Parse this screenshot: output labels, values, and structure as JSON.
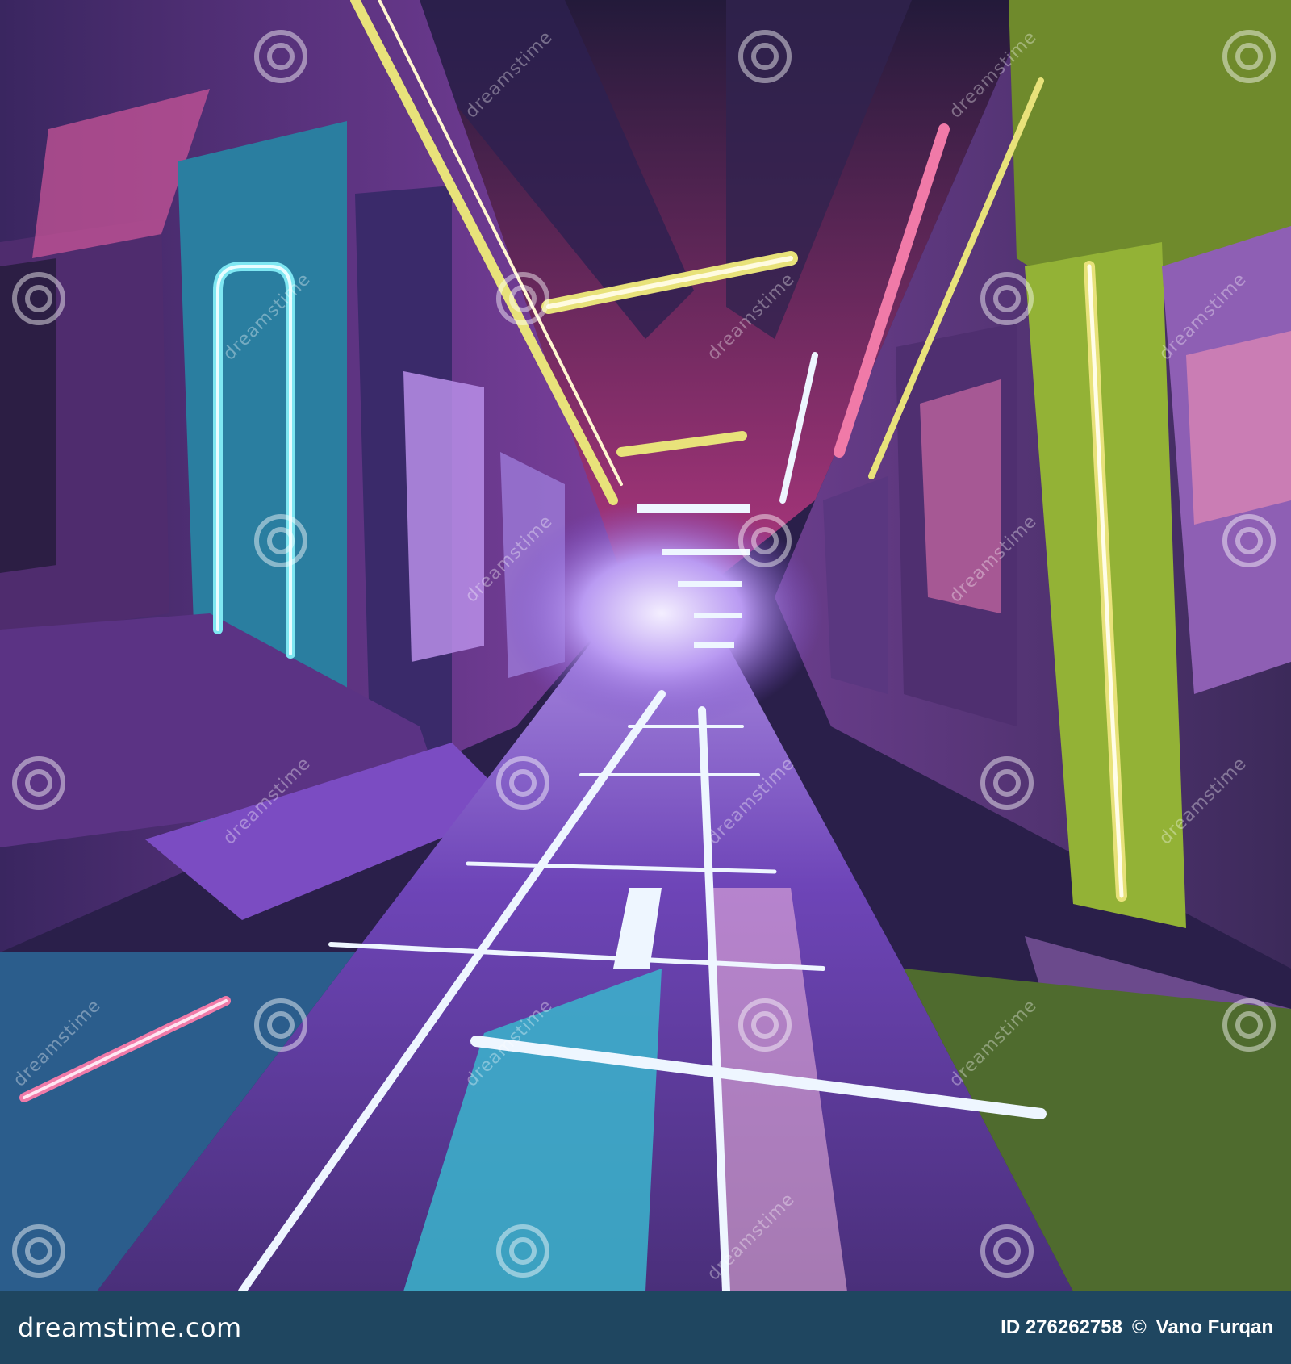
{
  "footer": {
    "brand_text": "dreamstime.com",
    "image_id": "ID 276262758",
    "copyright_symbol": "©",
    "author": "Vano Furqan"
  },
  "watermark": {
    "text": "dreamstime",
    "icon": "spiral-icon"
  },
  "artwork": {
    "subject": "neon-lit alley corridor",
    "palette": {
      "deep_purple": "#2a1f4a",
      "violet": "#7a4fc8",
      "magenta": "#c8418f",
      "pink": "#f07aa8",
      "cyan": "#3fc4d8",
      "lime": "#a7c43a",
      "yellow": "#e8e27a",
      "white_glow": "#eef6ff"
    }
  },
  "colors": {
    "footer_bg": "#1f4660",
    "footer_text": "#ffffff"
  }
}
